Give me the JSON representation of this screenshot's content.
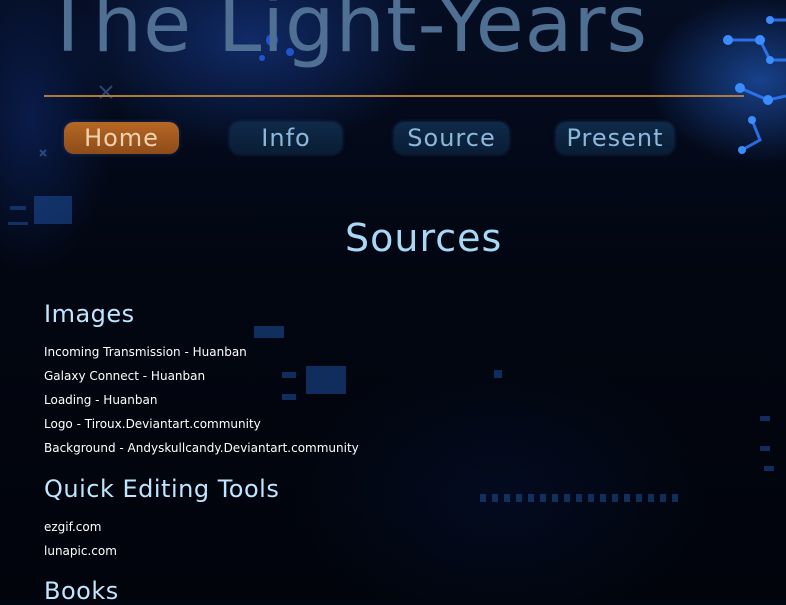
{
  "header": {
    "title": "The Light-Years"
  },
  "nav": {
    "items": [
      {
        "label": "Home",
        "active": true
      },
      {
        "label": "Info",
        "active": false
      },
      {
        "label": "Source",
        "active": false
      },
      {
        "label": "Present",
        "active": false
      }
    ]
  },
  "main": {
    "title": "Sources",
    "sections": [
      {
        "heading": "Images",
        "items": [
          "Incoming Transmission - Huanban",
          "Galaxy Connect - Huanban",
          "Loading - Huanban",
          "Logo - Tiroux.Deviantart.community",
          "Background - Andyskullcandy.Deviantart.community"
        ]
      },
      {
        "heading": "Quick Editing Tools",
        "items": [
          "ezgif.com",
          "lunapic.com"
        ]
      },
      {
        "heading": "Books",
        "items": []
      }
    ]
  },
  "colors": {
    "background": "#020611",
    "title": "#4f6f93",
    "rule": "#b0783a",
    "nav_active": "#b76724",
    "nav_inactive": "#0f2a49",
    "heading": "#bfe6ff",
    "page_title": "#a8d8f6"
  }
}
